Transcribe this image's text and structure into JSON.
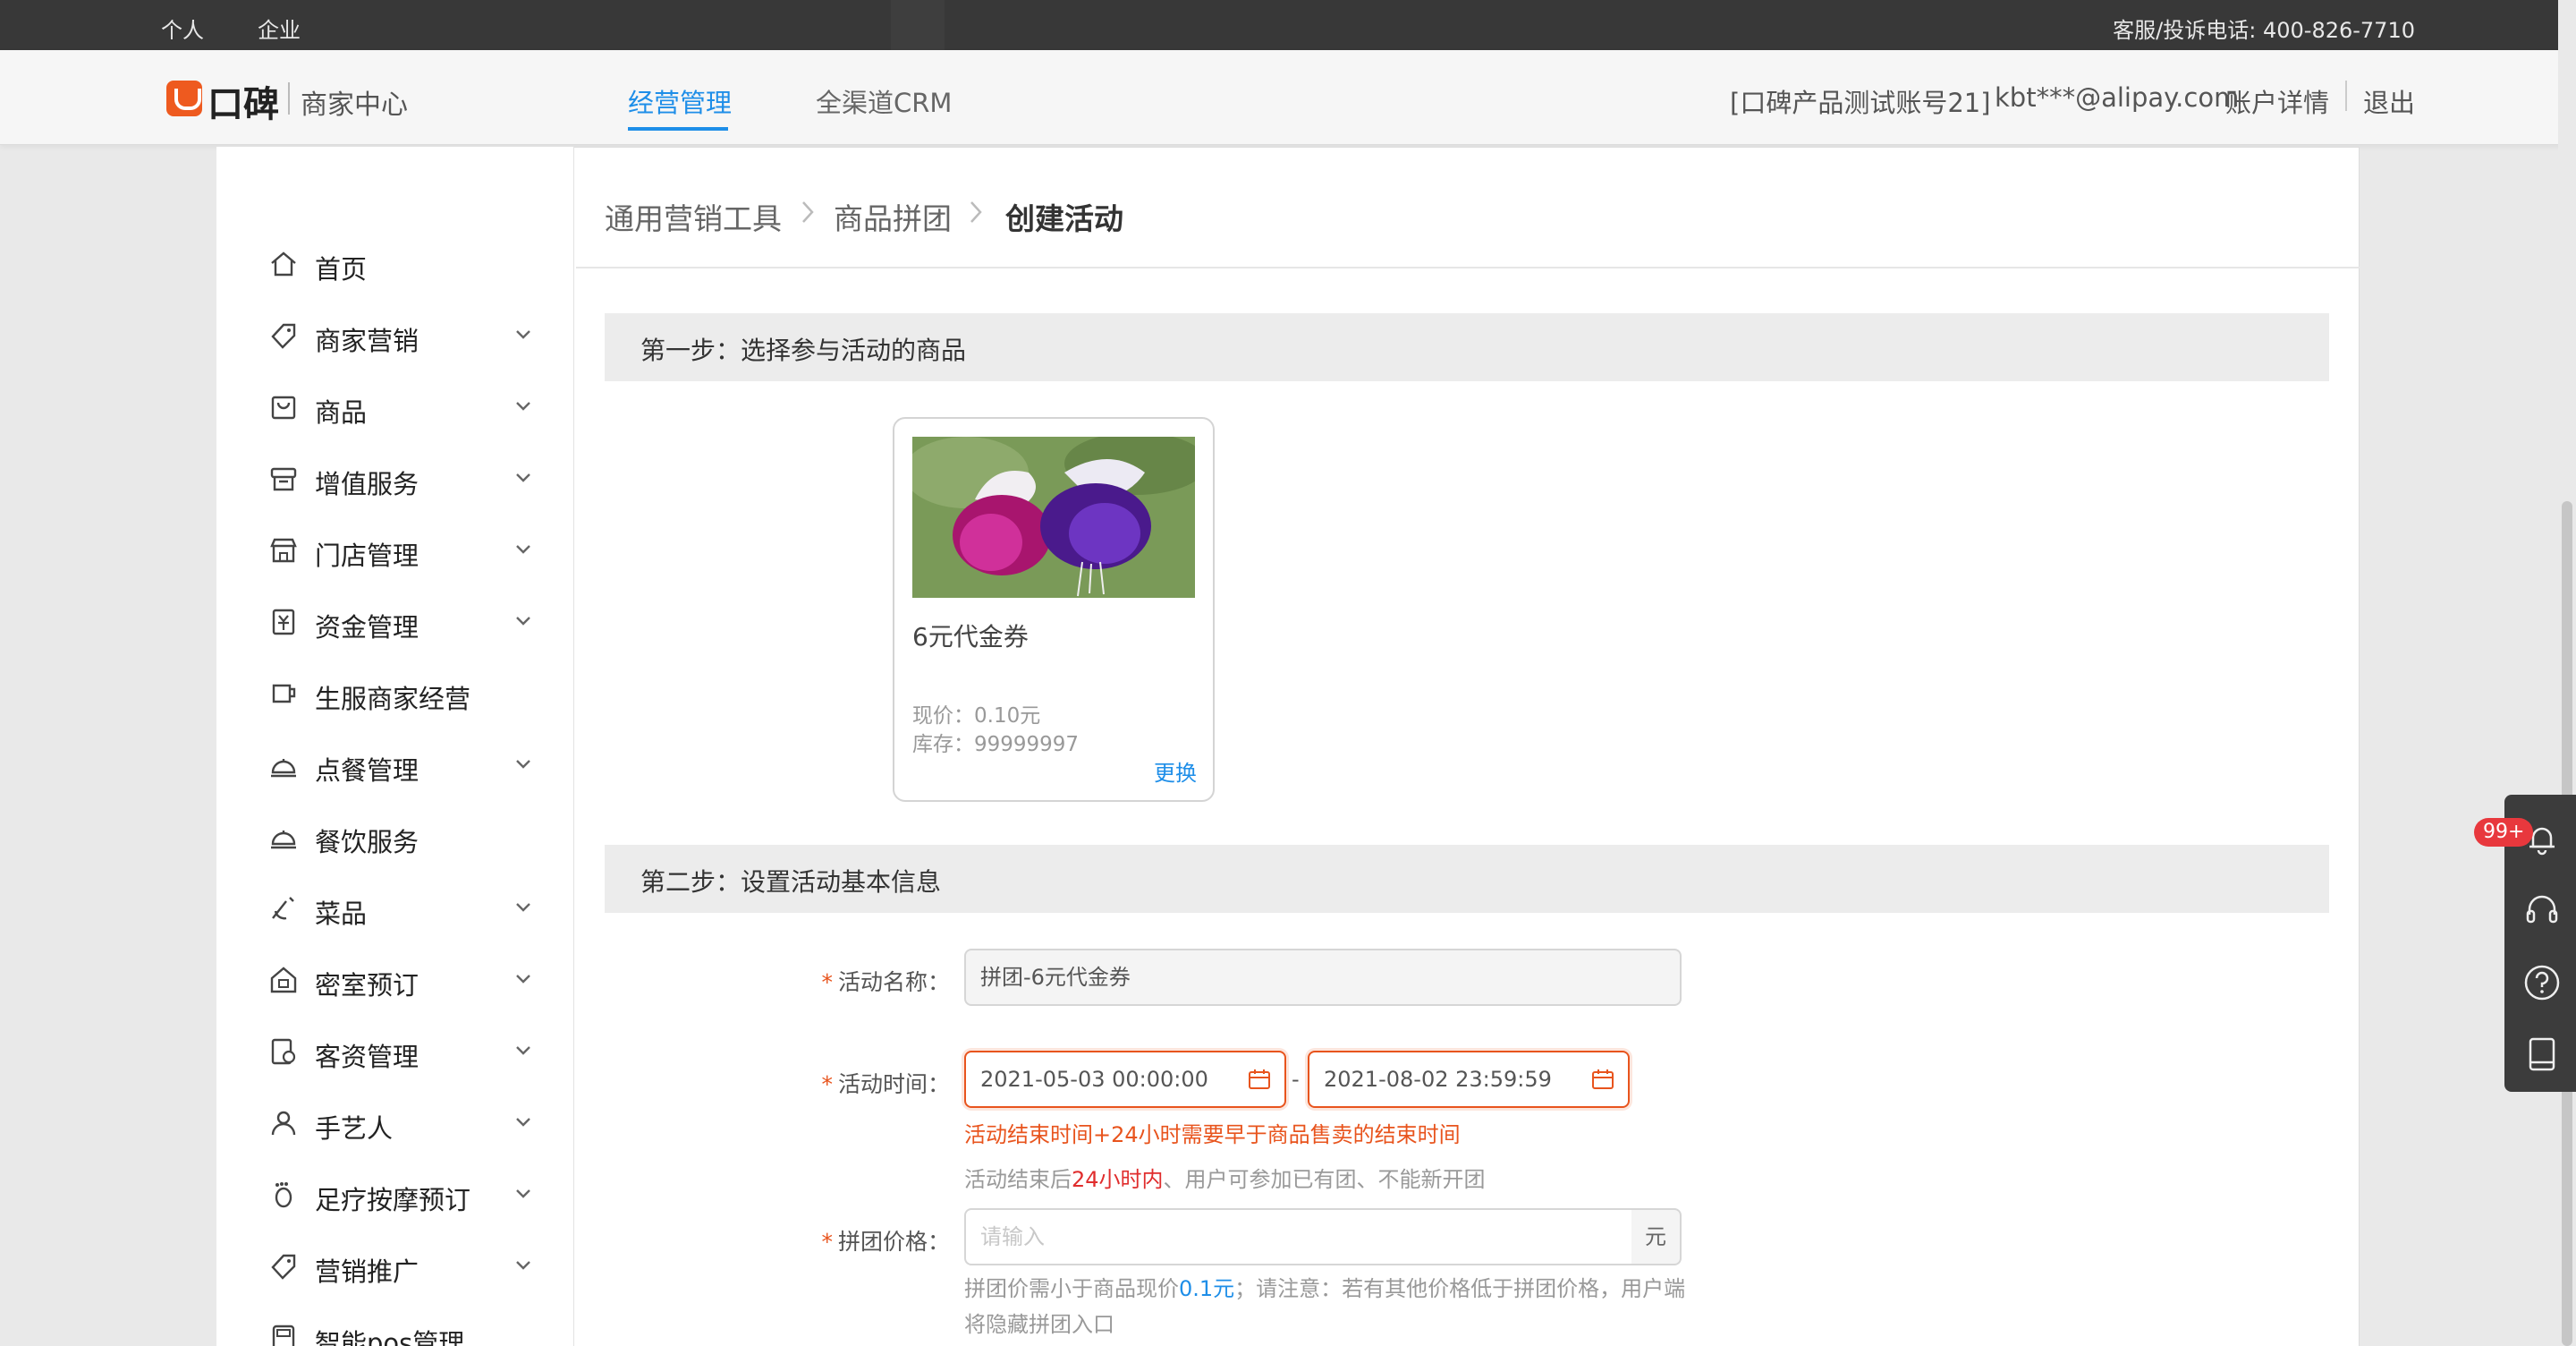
{
  "topbar": {
    "personal": "个人",
    "enterprise": "企业",
    "hotline": "客服/投诉电话: 400-826-7710"
  },
  "header": {
    "logo_text": "口碑",
    "logo_sub": "商家中心",
    "tabs": [
      {
        "label": "经营管理",
        "active": true
      },
      {
        "label": "全渠道CRM",
        "active": false
      }
    ],
    "account_name": "[口碑产品测试账号21]",
    "account_email": "kbt***@alipay.com",
    "account_detail": "账户详情",
    "logout": "退出"
  },
  "sidebar": {
    "items": [
      {
        "label": "首页",
        "icon": "home-icon",
        "expandable": false
      },
      {
        "label": "商家营销",
        "icon": "tag-icon",
        "expandable": true
      },
      {
        "label": "商品",
        "icon": "bag-icon",
        "expandable": true
      },
      {
        "label": "增值服务",
        "icon": "service-icon",
        "expandable": true
      },
      {
        "label": "门店管理",
        "icon": "store-icon",
        "expandable": true
      },
      {
        "label": "资金管理",
        "icon": "money-icon",
        "expandable": true
      },
      {
        "label": "生服商家经营",
        "icon": "cup-icon",
        "expandable": false
      },
      {
        "label": "点餐管理",
        "icon": "cloche-icon",
        "expandable": true
      },
      {
        "label": "餐饮服务",
        "icon": "cloche-icon",
        "expandable": false
      },
      {
        "label": "菜品",
        "icon": "dish-icon",
        "expandable": true
      },
      {
        "label": "密室预订",
        "icon": "lock-house-icon",
        "expandable": true
      },
      {
        "label": "客资管理",
        "icon": "customer-icon",
        "expandable": true
      },
      {
        "label": "手艺人",
        "icon": "person-icon",
        "expandable": true
      },
      {
        "label": "足疗按摩预订",
        "icon": "foot-icon",
        "expandable": true
      },
      {
        "label": "营销推广",
        "icon": "tag-icon",
        "expandable": true
      },
      {
        "label": "智能pos管理",
        "icon": "pos-icon",
        "expandable": false
      }
    ]
  },
  "breadcrumb": [
    "通用营销工具",
    "商品拼团",
    "创建活动"
  ],
  "step1": {
    "title": "第一步：选择参与活动的商品",
    "product": {
      "name": "6元代金券",
      "price": "现价：0.10元",
      "stock": "库存：99999997",
      "change": "更换"
    }
  },
  "step2": {
    "title": "第二步：设置活动基本信息",
    "name_label": "活动名称：",
    "name_value": "拼团-6元代金券",
    "time_label": "活动时间：",
    "start_time": "2021-05-03 00:00:00",
    "end_time": "2021-08-02 23:59:59",
    "range_sep": "-",
    "time_error": "活动结束时间+24小时需要早于商品售卖的结束时间",
    "time_hint_prefix": "活动结束后",
    "time_hint_highlight": "24小时内",
    "time_hint_suffix": "、用户可参加已有团、不能新开团",
    "price_label": "拼团价格：",
    "price_placeholder": "请输入",
    "price_unit": "元",
    "price_hint_1": "拼团价需小于商品现价",
    "price_hint_value": "0.1元",
    "price_hint_2": "；请注意：若有其他价格低于拼团价格，用户端",
    "price_hint_3": "将隐藏拼团入口"
  },
  "float_toolbar": {
    "badge": "99+",
    "tools": [
      "bell-icon",
      "headset-icon",
      "help-icon",
      "tablet-icon"
    ]
  },
  "colors": {
    "brand_orange": "#ee5a1f",
    "link_blue": "#1e8ee8",
    "error_orange": "#e8541d",
    "topbar": "#383838"
  }
}
